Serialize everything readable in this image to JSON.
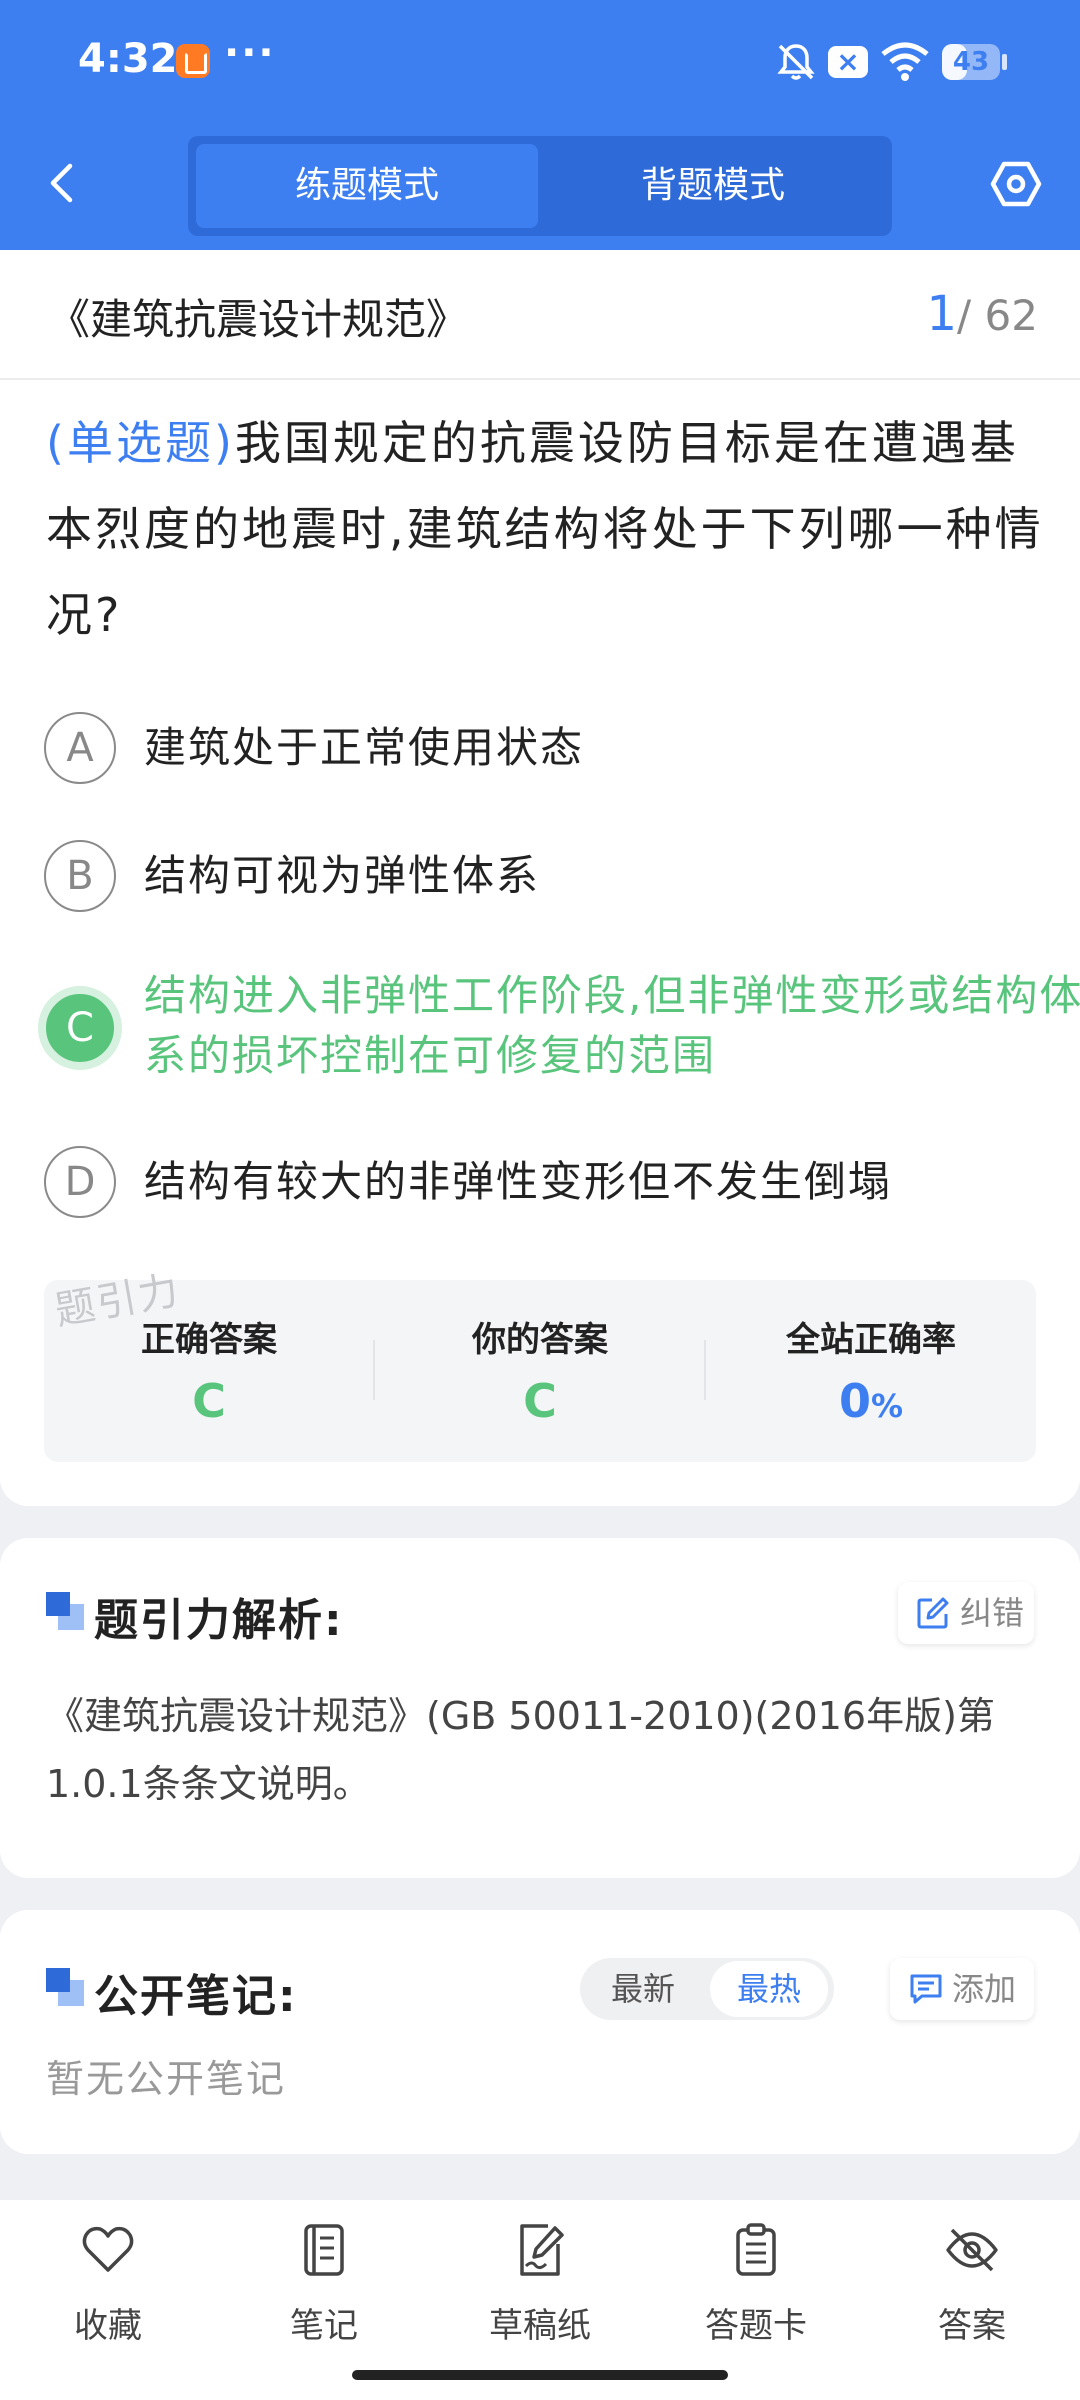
{
  "status_bar": {
    "time": "4:32",
    "dots": "···",
    "battery_level": "43",
    "icons": [
      "app-store-icon",
      "mute-bell-icon",
      "close-box-icon",
      "wifi-icon",
      "battery-icon"
    ]
  },
  "header": {
    "tabs": [
      {
        "label": "练题模式",
        "active": true
      },
      {
        "label": "背题模式",
        "active": false
      }
    ]
  },
  "question": {
    "book_title": "《建筑抗震设计规范》",
    "current": "1",
    "total": "/ 62",
    "type": "(单选题)",
    "text": "我国规定的抗震设防目标是在遭遇基本烈度的地震时,建筑结构将处于下列哪一种情况?",
    "options": [
      {
        "letter": "A",
        "text": "建筑处于正常使用状态",
        "state": "normal"
      },
      {
        "letter": "B",
        "text": "结构可视为弹性体系",
        "state": "normal"
      },
      {
        "letter": "C",
        "text": "结构进入非弹性工作阶段,但非弹性变形或结构体系的损坏控制在可修复的范围",
        "state": "correct"
      },
      {
        "letter": "D",
        "text": "结构有较大的非弹性变形但不发生倒塌",
        "state": "normal"
      }
    ],
    "watermark": "题引力"
  },
  "stats": {
    "correct_label": "正确答案",
    "correct_value": "C",
    "yours_label": "你的答案",
    "yours_value": "C",
    "rate_label": "全站正确率",
    "rate_value": "0",
    "rate_unit": "%"
  },
  "analysis": {
    "title": "题引力解析:",
    "report_label": "纠错",
    "text": "《建筑抗震设计规范》(GB 50011-2010)(2016年版)第1.0.1条条文说明。"
  },
  "notes": {
    "title": "公开笔记:",
    "sort_latest": "最新",
    "sort_hot": "最热",
    "sort_selected": "最热",
    "add_label": "添加",
    "empty_text": "暂无公开笔记"
  },
  "bottom_bar": {
    "items": [
      {
        "label": "收藏",
        "icon": "heart-icon"
      },
      {
        "label": "笔记",
        "icon": "notebook-icon"
      },
      {
        "label": "草稿纸",
        "icon": "draft-pen-icon"
      },
      {
        "label": "答题卡",
        "icon": "answer-sheet-icon"
      },
      {
        "label": "答案",
        "icon": "eye-off-icon"
      }
    ]
  },
  "colors": {
    "primary": "#3d7ef0",
    "correct": "#58c47c",
    "background": "#eef0f4"
  }
}
